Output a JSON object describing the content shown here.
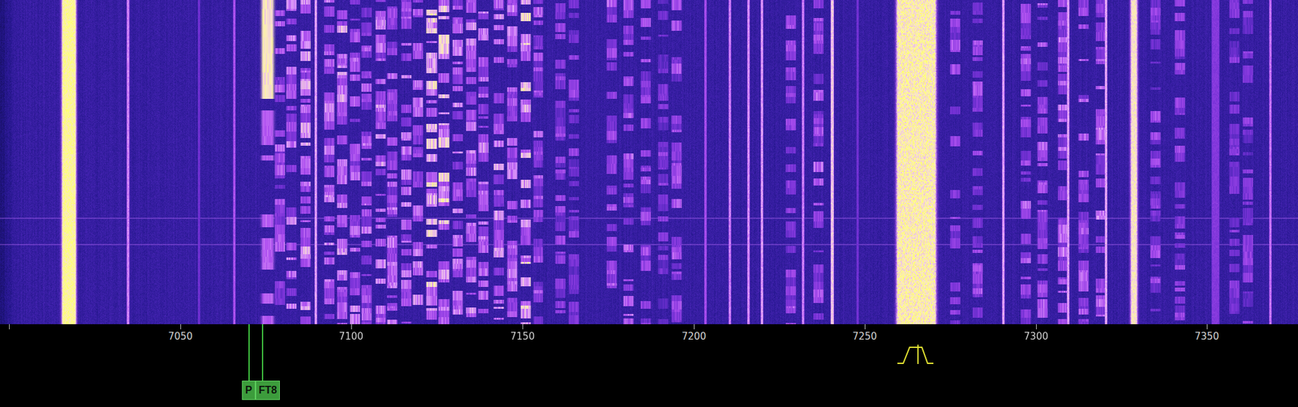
{
  "waterfall": {
    "span_khz": {
      "start": 6997.3,
      "end": 7376.6
    },
    "burst_rows": [
      0.672,
      0.753
    ],
    "signals": [
      {
        "khz": 7017.4,
        "width_khz": 3.2,
        "intensity": 1.0,
        "kind": "carrier"
      },
      {
        "khz": 7034.8,
        "width_khz": 0.5,
        "intensity": 0.8,
        "kind": "carrier"
      },
      {
        "khz": 7055.5,
        "width_khz": 0.3,
        "intensity": 0.55,
        "kind": "carrier"
      },
      {
        "khz": 7065.8,
        "width_khz": 0.3,
        "intensity": 0.72,
        "kind": "carrier"
      },
      {
        "khz": 7075.6,
        "width_khz": 2.2,
        "intensity": 0.97,
        "kind": "digital"
      },
      {
        "khz": 7079.0,
        "width_khz": 2.6,
        "intensity": 0.68,
        "kind": "voice"
      },
      {
        "khz": 7082.5,
        "width_khz": 2.6,
        "intensity": 0.72,
        "kind": "voice"
      },
      {
        "khz": 7086.5,
        "width_khz": 2.6,
        "intensity": 0.75,
        "kind": "voice"
      },
      {
        "khz": 7089.5,
        "width_khz": 0.4,
        "intensity": 0.85,
        "kind": "carrier"
      },
      {
        "khz": 7093.5,
        "width_khz": 2.6,
        "intensity": 0.74,
        "kind": "voice"
      },
      {
        "khz": 7097.3,
        "width_khz": 2.6,
        "intensity": 0.76,
        "kind": "voice"
      },
      {
        "khz": 7101.0,
        "width_khz": 2.6,
        "intensity": 0.72,
        "kind": "voice"
      },
      {
        "khz": 7104.5,
        "width_khz": 2.6,
        "intensity": 0.7,
        "kind": "voice"
      },
      {
        "khz": 7108.5,
        "width_khz": 2.6,
        "intensity": 0.74,
        "kind": "voice"
      },
      {
        "khz": 7112.0,
        "width_khz": 2.6,
        "intensity": 0.7,
        "kind": "voice"
      },
      {
        "khz": 7116.0,
        "width_khz": 2.6,
        "intensity": 0.72,
        "kind": "voice"
      },
      {
        "khz": 7119.5,
        "width_khz": 2.6,
        "intensity": 0.74,
        "kind": "voice"
      },
      {
        "khz": 7123.5,
        "width_khz": 2.8,
        "intensity": 0.85,
        "kind": "voice"
      },
      {
        "khz": 7127.0,
        "width_khz": 2.8,
        "intensity": 0.86,
        "kind": "voice"
      },
      {
        "khz": 7131.0,
        "width_khz": 2.6,
        "intensity": 0.72,
        "kind": "voice"
      },
      {
        "khz": 7135.0,
        "width_khz": 2.6,
        "intensity": 0.74,
        "kind": "voice"
      },
      {
        "khz": 7138.5,
        "width_khz": 2.6,
        "intensity": 0.72,
        "kind": "voice"
      },
      {
        "khz": 7143.0,
        "width_khz": 2.6,
        "intensity": 0.74,
        "kind": "voice"
      },
      {
        "khz": 7147.0,
        "width_khz": 2.6,
        "intensity": 0.72,
        "kind": "voice"
      },
      {
        "khz": 7151.0,
        "width_khz": 2.6,
        "intensity": 0.84,
        "kind": "voice"
      },
      {
        "khz": 7154.5,
        "width_khz": 2.4,
        "intensity": 0.66,
        "kind": "voice"
      },
      {
        "khz": 7161.0,
        "width_khz": 2.6,
        "intensity": 0.62,
        "kind": "voice"
      },
      {
        "khz": 7165.0,
        "width_khz": 2.6,
        "intensity": 0.6,
        "kind": "voice"
      },
      {
        "khz": 7176.0,
        "width_khz": 2.6,
        "intensity": 0.66,
        "kind": "voice"
      },
      {
        "khz": 7181.0,
        "width_khz": 2.6,
        "intensity": 0.68,
        "kind": "voice"
      },
      {
        "khz": 7186.0,
        "width_khz": 2.6,
        "intensity": 0.64,
        "kind": "voice"
      },
      {
        "khz": 7191.0,
        "width_khz": 2.6,
        "intensity": 0.6,
        "kind": "voice"
      },
      {
        "khz": 7195.0,
        "width_khz": 2.6,
        "intensity": 0.64,
        "kind": "voice"
      },
      {
        "khz": 7203.5,
        "width_khz": 0.4,
        "intensity": 0.7,
        "kind": "carrier"
      },
      {
        "khz": 7210.5,
        "width_khz": 0.4,
        "intensity": 0.8,
        "kind": "carrier"
      },
      {
        "khz": 7216.0,
        "width_khz": 0.4,
        "intensity": 0.82,
        "kind": "carrier"
      },
      {
        "khz": 7220.0,
        "width_khz": 0.4,
        "intensity": 0.84,
        "kind": "carrier"
      },
      {
        "khz": 7228.5,
        "width_khz": 2.6,
        "intensity": 0.66,
        "kind": "voice"
      },
      {
        "khz": 7232.0,
        "width_khz": 0.4,
        "intensity": 0.8,
        "kind": "carrier"
      },
      {
        "khz": 7236.5,
        "width_khz": 2.6,
        "intensity": 0.66,
        "kind": "voice"
      },
      {
        "khz": 7240.5,
        "width_khz": 0.6,
        "intensity": 0.9,
        "kind": "carrier"
      },
      {
        "khz": 7248.0,
        "width_khz": 0.4,
        "intensity": 0.55,
        "kind": "carrier"
      },
      {
        "khz": 7265.0,
        "width_khz": 10.4,
        "intensity": 1.0,
        "kind": "broadcast"
      },
      {
        "khz": 7276.5,
        "width_khz": 2.6,
        "intensity": 0.64,
        "kind": "voice"
      },
      {
        "khz": 7283.0,
        "width_khz": 2.6,
        "intensity": 0.64,
        "kind": "voice"
      },
      {
        "khz": 7290.5,
        "width_khz": 0.4,
        "intensity": 0.85,
        "kind": "carrier"
      },
      {
        "khz": 7297.0,
        "width_khz": 2.6,
        "intensity": 0.66,
        "kind": "voice"
      },
      {
        "khz": 7302.0,
        "width_khz": 2.6,
        "intensity": 0.66,
        "kind": "voice"
      },
      {
        "khz": 7308.0,
        "width_khz": 2.6,
        "intensity": 0.7,
        "kind": "voice"
      },
      {
        "khz": 7309.4,
        "width_khz": 0.4,
        "intensity": 0.85,
        "kind": "carrier"
      },
      {
        "khz": 7314.0,
        "width_khz": 2.6,
        "intensity": 0.66,
        "kind": "voice"
      },
      {
        "khz": 7319.0,
        "width_khz": 2.6,
        "intensity": 0.7,
        "kind": "voice"
      },
      {
        "khz": 7320.5,
        "width_khz": 0.4,
        "intensity": 0.86,
        "kind": "carrier"
      },
      {
        "khz": 7328.7,
        "width_khz": 1.0,
        "intensity": 0.95,
        "kind": "carrier"
      },
      {
        "khz": 7335.0,
        "width_khz": 2.6,
        "intensity": 0.62,
        "kind": "voice"
      },
      {
        "khz": 7342.0,
        "width_khz": 2.6,
        "intensity": 0.62,
        "kind": "voice"
      },
      {
        "khz": 7352.5,
        "width_khz": 2.0,
        "intensity": 0.6,
        "kind": "carrier"
      },
      {
        "khz": 7358.0,
        "width_khz": 2.6,
        "intensity": 0.6,
        "kind": "voice"
      },
      {
        "khz": 7362.0,
        "width_khz": 2.6,
        "intensity": 0.6,
        "kind": "voice"
      },
      {
        "khz": 7368.5,
        "width_khz": 0.4,
        "intensity": 0.78,
        "kind": "carrier"
      }
    ]
  },
  "scale": {
    "unlabeled_ticks_khz": [
      7000
    ],
    "ticks": [
      {
        "khz": 7050,
        "label": "7050"
      },
      {
        "khz": 7100,
        "label": "7100"
      },
      {
        "khz": 7150,
        "label": "7150"
      },
      {
        "khz": 7200,
        "label": "7200"
      },
      {
        "khz": 7250,
        "label": "7250"
      },
      {
        "khz": 7300,
        "label": "7300"
      },
      {
        "khz": 7350,
        "label": "7350"
      }
    ]
  },
  "passband": {
    "low_khz": 7259.5,
    "high_khz": 7270.0,
    "carrier_khz": 7265.5
  },
  "bookmarks": [
    {
      "label": "P",
      "khz": 7070
    },
    {
      "label": "FT8",
      "khz": 7074
    }
  ]
}
